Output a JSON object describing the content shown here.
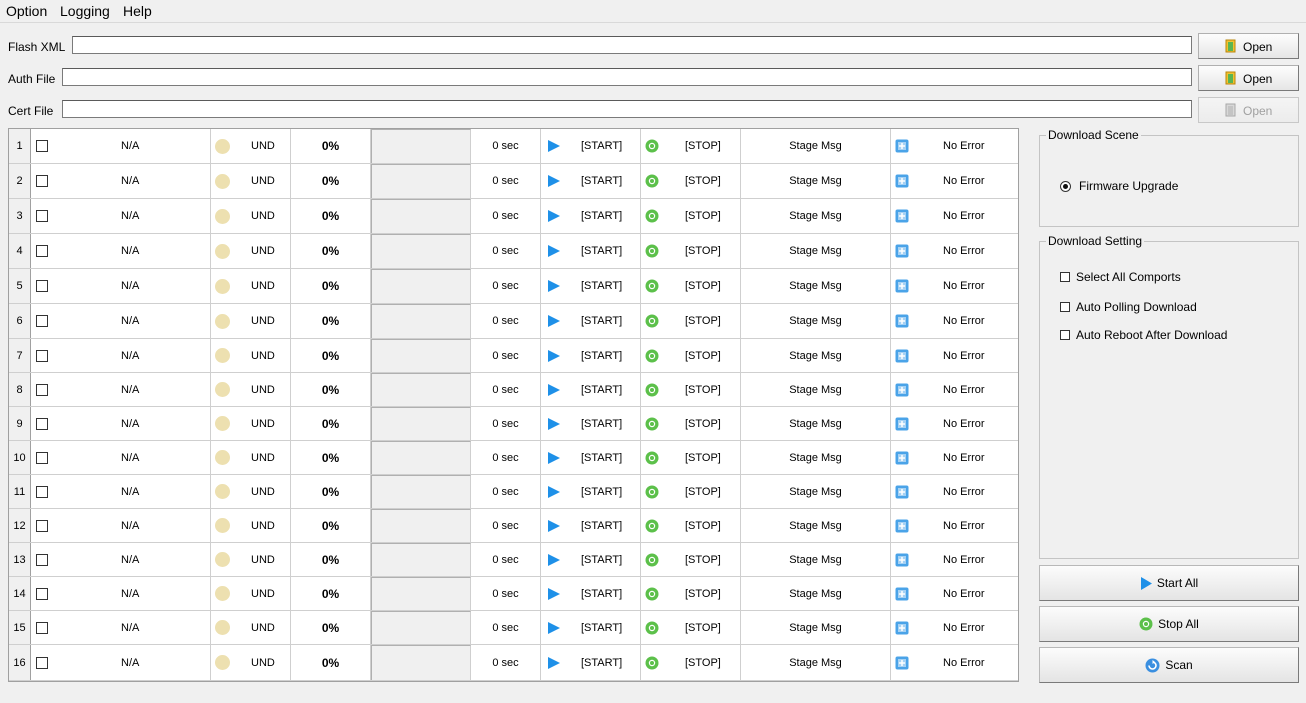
{
  "menu": {
    "items": [
      "Option",
      "Logging",
      "Help"
    ]
  },
  "files": [
    {
      "label": "Flash XML",
      "value": "",
      "button": "Open",
      "enabled": true
    },
    {
      "label": "Auth File",
      "value": "",
      "button": "Open",
      "enabled": true
    },
    {
      "label": "Cert File",
      "value": "",
      "button": "Open",
      "enabled": false
    }
  ],
  "ports": [
    {
      "num": "1",
      "port": "N/A",
      "state": "UND",
      "progress": "0%",
      "time": "0 sec",
      "start": "[START]",
      "stop": "[STOP]",
      "stage": "Stage Msg",
      "error": "No Error"
    },
    {
      "num": "2",
      "port": "N/A",
      "state": "UND",
      "progress": "0%",
      "time": "0 sec",
      "start": "[START]",
      "stop": "[STOP]",
      "stage": "Stage Msg",
      "error": "No Error"
    },
    {
      "num": "3",
      "port": "N/A",
      "state": "UND",
      "progress": "0%",
      "time": "0 sec",
      "start": "[START]",
      "stop": "[STOP]",
      "stage": "Stage Msg",
      "error": "No Error"
    },
    {
      "num": "4",
      "port": "N/A",
      "state": "UND",
      "progress": "0%",
      "time": "0 sec",
      "start": "[START]",
      "stop": "[STOP]",
      "stage": "Stage Msg",
      "error": "No Error"
    },
    {
      "num": "5",
      "port": "N/A",
      "state": "UND",
      "progress": "0%",
      "time": "0 sec",
      "start": "[START]",
      "stop": "[STOP]",
      "stage": "Stage Msg",
      "error": "No Error"
    },
    {
      "num": "6",
      "port": "N/A",
      "state": "UND",
      "progress": "0%",
      "time": "0 sec",
      "start": "[START]",
      "stop": "[STOP]",
      "stage": "Stage Msg",
      "error": "No Error"
    },
    {
      "num": "7",
      "port": "N/A",
      "state": "UND",
      "progress": "0%",
      "time": "0 sec",
      "start": "[START]",
      "stop": "[STOP]",
      "stage": "Stage Msg",
      "error": "No Error"
    },
    {
      "num": "8",
      "port": "N/A",
      "state": "UND",
      "progress": "0%",
      "time": "0 sec",
      "start": "[START]",
      "stop": "[STOP]",
      "stage": "Stage Msg",
      "error": "No Error"
    },
    {
      "num": "9",
      "port": "N/A",
      "state": "UND",
      "progress": "0%",
      "time": "0 sec",
      "start": "[START]",
      "stop": "[STOP]",
      "stage": "Stage Msg",
      "error": "No Error"
    },
    {
      "num": "10",
      "port": "N/A",
      "state": "UND",
      "progress": "0%",
      "time": "0 sec",
      "start": "[START]",
      "stop": "[STOP]",
      "stage": "Stage Msg",
      "error": "No Error"
    },
    {
      "num": "11",
      "port": "N/A",
      "state": "UND",
      "progress": "0%",
      "time": "0 sec",
      "start": "[START]",
      "stop": "[STOP]",
      "stage": "Stage Msg",
      "error": "No Error"
    },
    {
      "num": "12",
      "port": "N/A",
      "state": "UND",
      "progress": "0%",
      "time": "0 sec",
      "start": "[START]",
      "stop": "[STOP]",
      "stage": "Stage Msg",
      "error": "No Error"
    },
    {
      "num": "13",
      "port": "N/A",
      "state": "UND",
      "progress": "0%",
      "time": "0 sec",
      "start": "[START]",
      "stop": "[STOP]",
      "stage": "Stage Msg",
      "error": "No Error"
    },
    {
      "num": "14",
      "port": "N/A",
      "state": "UND",
      "progress": "0%",
      "time": "0 sec",
      "start": "[START]",
      "stop": "[STOP]",
      "stage": "Stage Msg",
      "error": "No Error"
    },
    {
      "num": "15",
      "port": "N/A",
      "state": "UND",
      "progress": "0%",
      "time": "0 sec",
      "start": "[START]",
      "stop": "[STOP]",
      "stage": "Stage Msg",
      "error": "No Error"
    },
    {
      "num": "16",
      "port": "N/A",
      "state": "UND",
      "progress": "0%",
      "time": "0 sec",
      "start": "[START]",
      "stop": "[STOP]",
      "stage": "Stage Msg",
      "error": "No Error"
    }
  ],
  "download_scene": {
    "title": "Download Scene",
    "option": "Firmware Upgrade",
    "selected": true
  },
  "download_setting": {
    "title": "Download Setting",
    "options": [
      {
        "label": "Select All Comports",
        "checked": false
      },
      {
        "label": "Auto Polling Download",
        "checked": false
      },
      {
        "label": "Auto Reboot After Download",
        "checked": false
      }
    ]
  },
  "actions": {
    "start_all": "Start All",
    "stop_all": "Stop All",
    "scan": "Scan"
  },
  "colors": {
    "state_dot": "#ede0b0",
    "start_icon": "#1e90e8",
    "stop_icon": "#5cc04a",
    "error_icon": "#4aa3e8",
    "window_bg": "#f0f0f0"
  },
  "icons": {
    "open": "folder-open-icon",
    "start": "play-icon",
    "stop": "stop-circle-icon",
    "error": "plus-box-icon",
    "scan": "refresh-icon"
  }
}
